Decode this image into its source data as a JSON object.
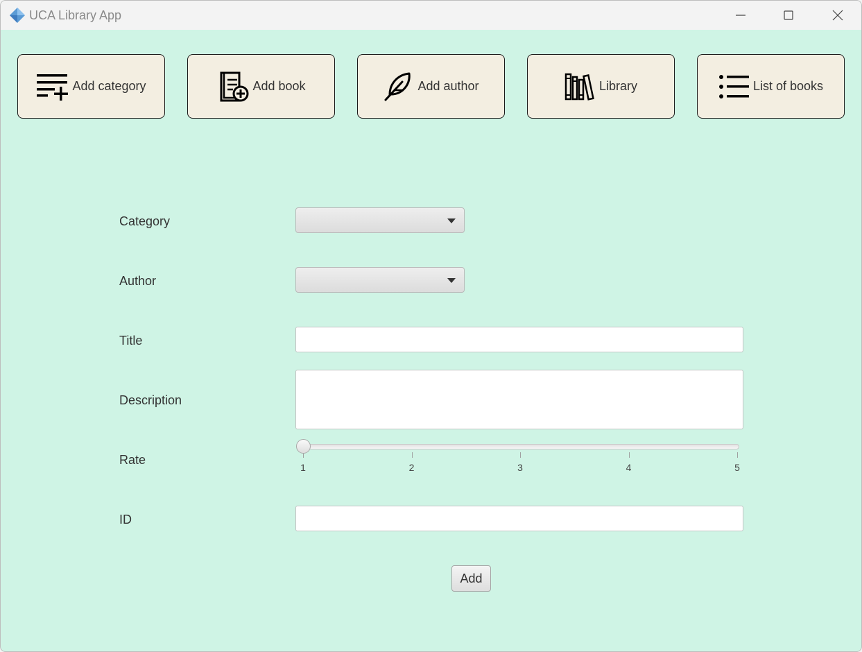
{
  "window": {
    "title": "UCA Library App"
  },
  "nav": [
    {
      "label": "Add category",
      "icon": "add-list-icon"
    },
    {
      "label": "Add book",
      "icon": "add-book-icon"
    },
    {
      "label": "Add author",
      "icon": "feather-icon"
    },
    {
      "label": "Library",
      "icon": "bookshelf-icon"
    },
    {
      "label": "List of books",
      "icon": "list-icon"
    }
  ],
  "form": {
    "category_label": "Category",
    "category_value": "",
    "author_label": "Author",
    "author_value": "",
    "title_label": "Title",
    "title_value": "",
    "description_label": "Description",
    "description_value": "",
    "rate_label": "Rate",
    "rate_value": 1,
    "rate_min": 1,
    "rate_max": 5,
    "rate_ticks": [
      "1",
      "2",
      "3",
      "4",
      "5"
    ],
    "id_label": "ID",
    "id_value": "",
    "submit_label": "Add"
  },
  "colors": {
    "background": "#cff4e5",
    "nav_button": "#f3eee1",
    "titlebar": "#f3f3f3"
  }
}
